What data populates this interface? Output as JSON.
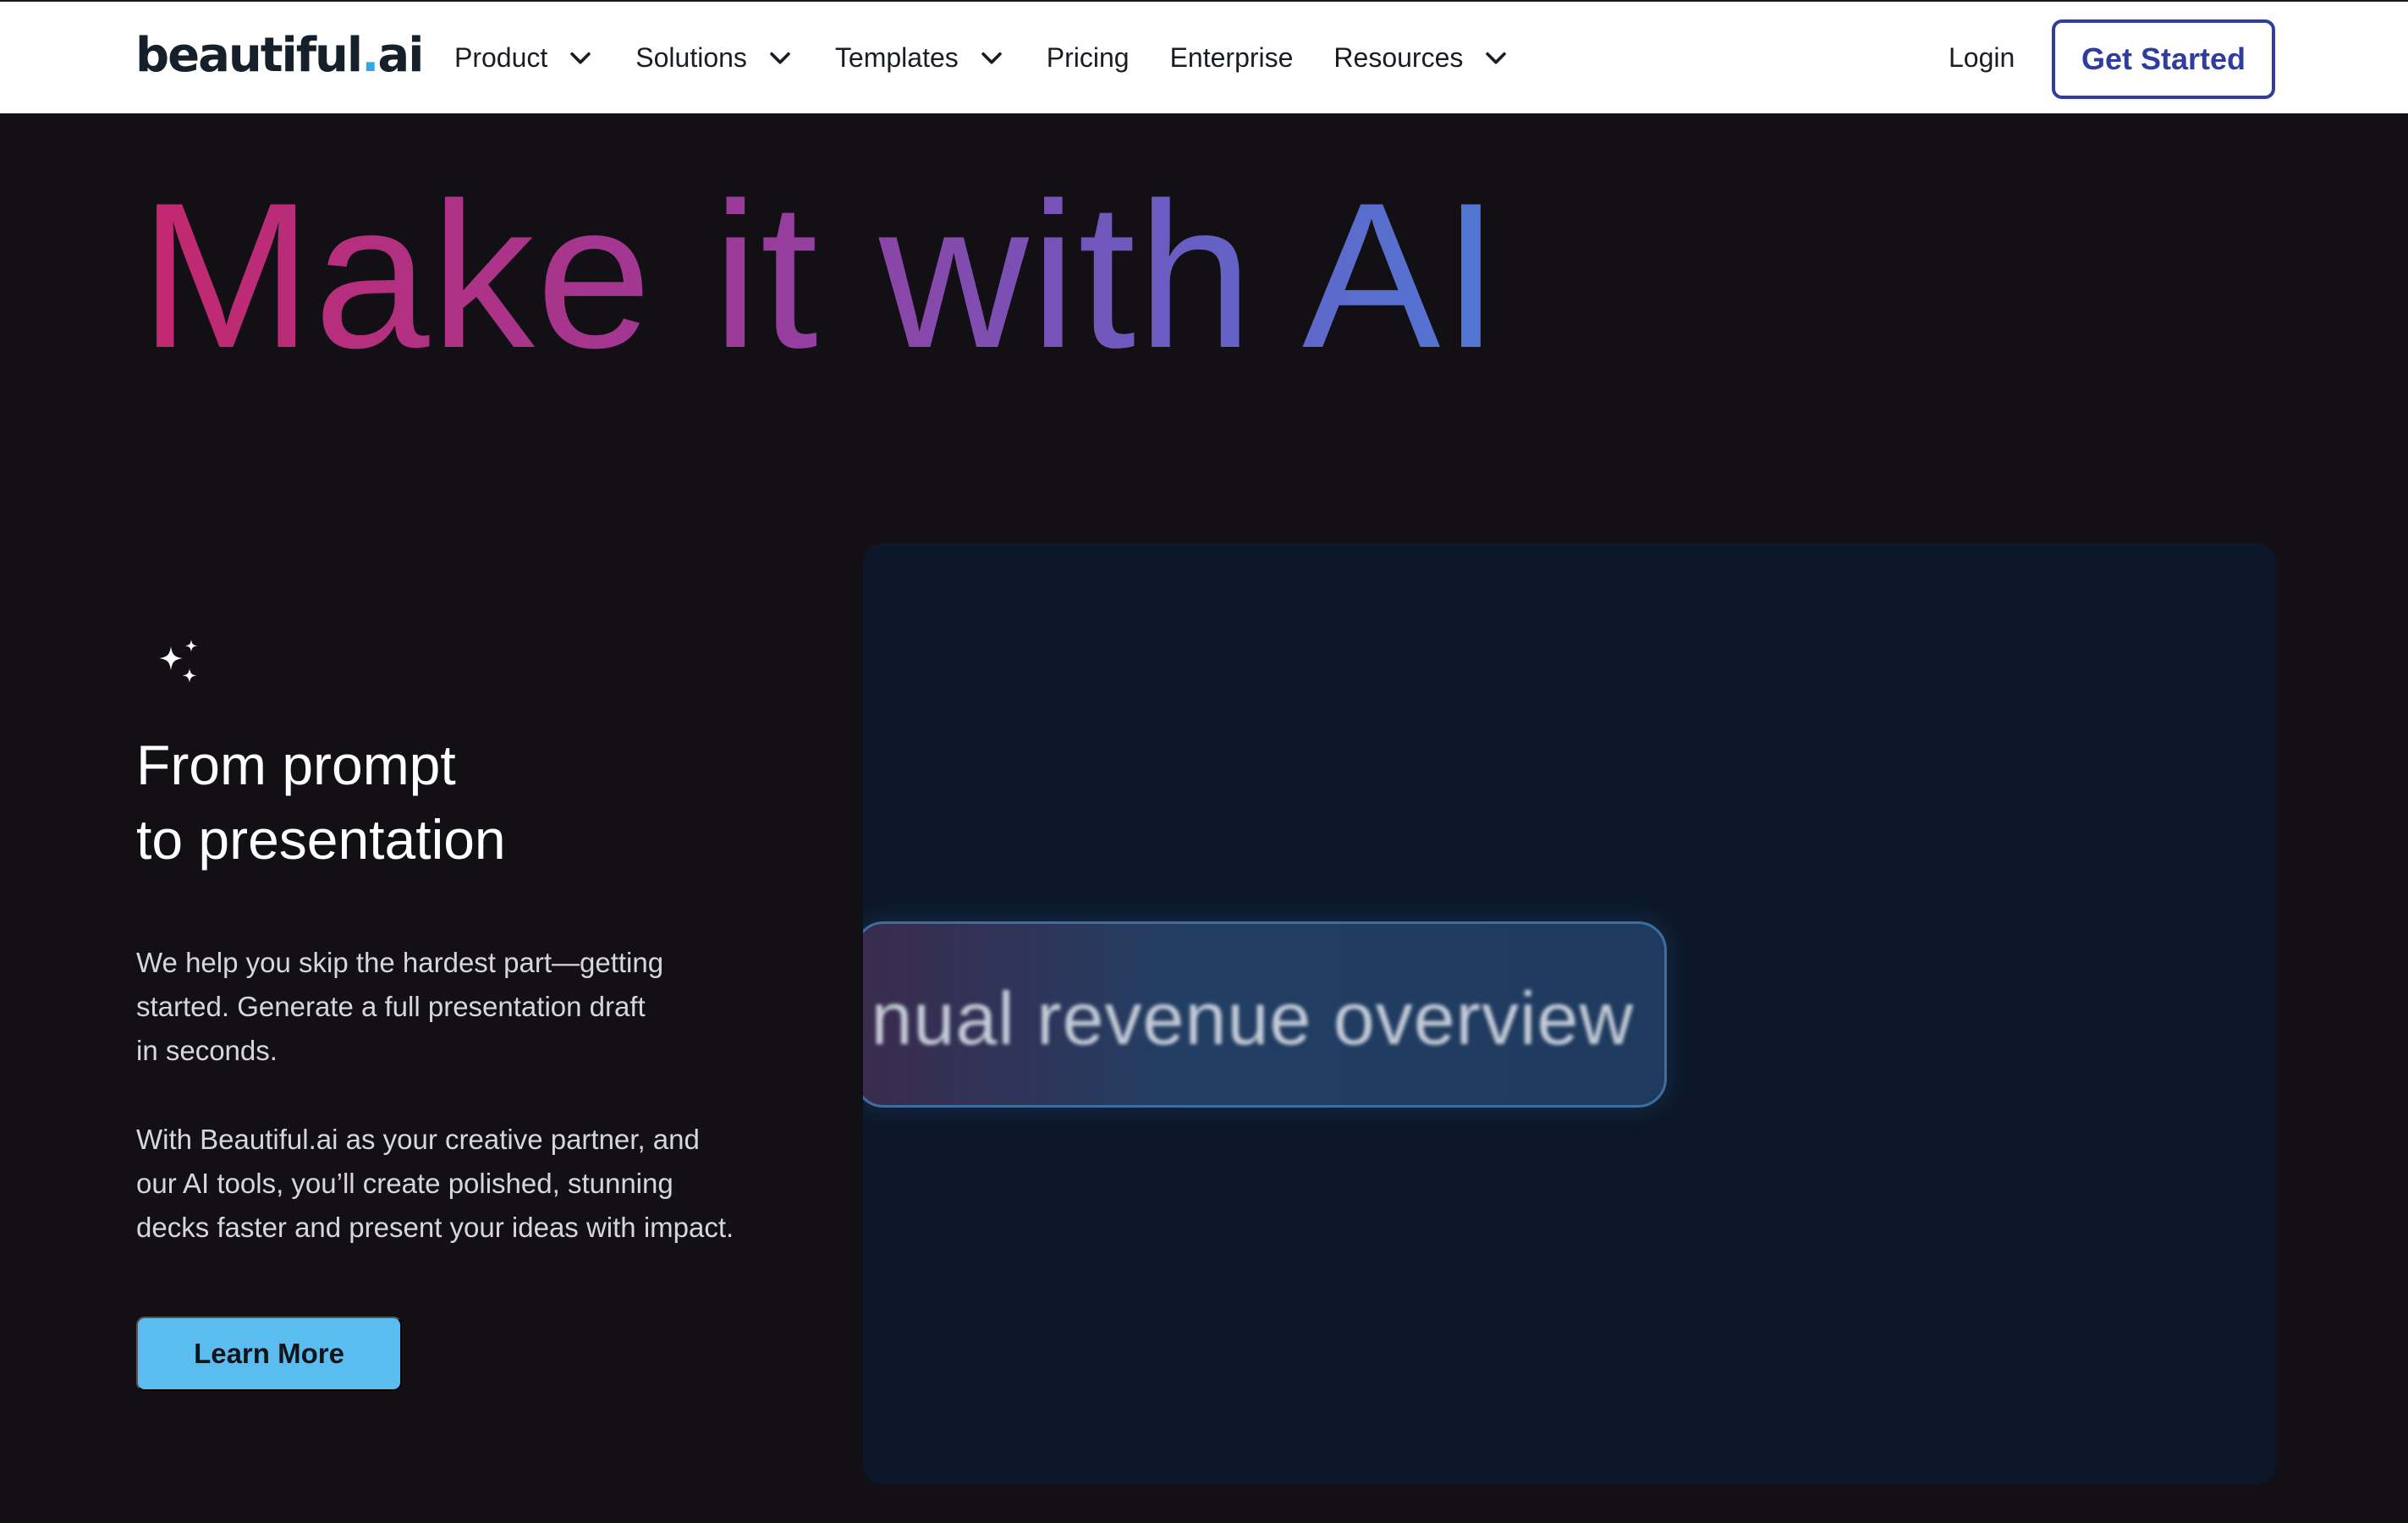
{
  "header": {
    "logo": {
      "word": "beautiful",
      "dot": ".",
      "suffix": "ai"
    },
    "nav": [
      {
        "label": "Product",
        "has_dropdown": true
      },
      {
        "label": "Solutions",
        "has_dropdown": true
      },
      {
        "label": "Templates",
        "has_dropdown": true
      },
      {
        "label": "Pricing",
        "has_dropdown": false
      },
      {
        "label": "Enterprise",
        "has_dropdown": false
      },
      {
        "label": "Resources",
        "has_dropdown": true
      }
    ],
    "login_label": "Login",
    "cta_label": "Get Started"
  },
  "hero": {
    "title": "Make it with AI"
  },
  "feature": {
    "icon": "sparkles-icon",
    "title_lines": [
      "From prompt",
      "to presentation"
    ],
    "paragraph1_lines": [
      "We help you skip the hardest part—getting",
      "started. Generate a full presentation draft",
      "in seconds."
    ],
    "paragraph2_lines": [
      "With Beautiful.ai as your creative partner, and",
      "our AI tools, you’ll create polished, stunning",
      "decks faster and present your ideas with impact."
    ],
    "button_label": "Learn More"
  },
  "media": {
    "prompt_text": "nual revenue overview"
  },
  "colors": {
    "background": "#121015",
    "header_bg": "#ffffff",
    "cta_border": "#2f3d9e",
    "learn_more_bg": "#5bbcf0",
    "media_bg": "#0c1829",
    "gradient_start": "#c4286e",
    "gradient_end": "#4f78d4"
  }
}
